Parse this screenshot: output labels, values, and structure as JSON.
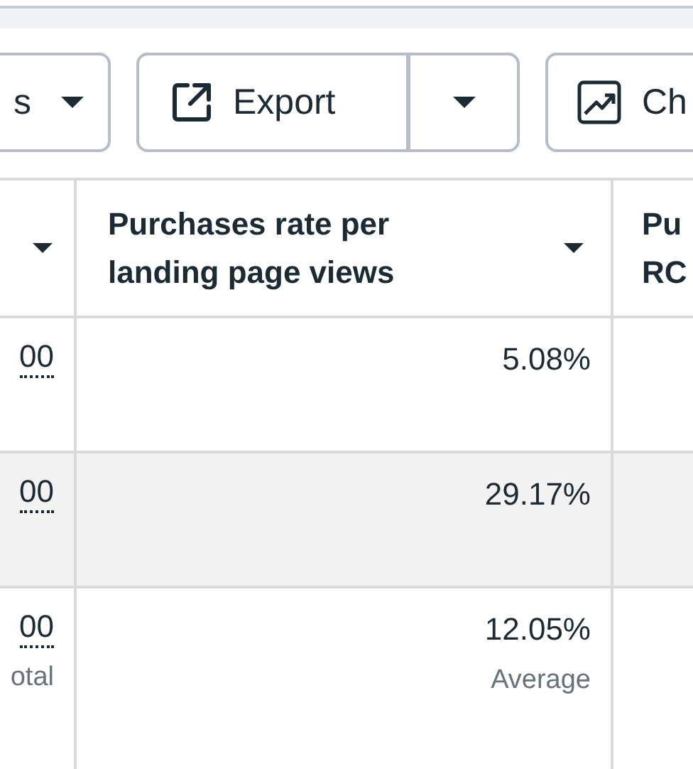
{
  "toolbar": [
    {
      "kind": "dropdown",
      "label": "s"
    },
    {
      "kind": "split",
      "label": "Export"
    },
    {
      "kind": "button",
      "label": "Ch"
    }
  ],
  "table": {
    "columns": [
      {
        "sort_menu": true
      },
      {
        "label": "Purchases rate per landing page views",
        "sort_menu": true
      },
      {
        "label": "Pu\nRC",
        "sort_menu": false
      }
    ],
    "rows": [
      {
        "highlighted": false,
        "cells": [
          {
            "value": "00",
            "kind": "link"
          },
          {
            "value": "5.08%"
          }
        ]
      },
      {
        "highlighted": true,
        "cells": [
          {
            "value": "00",
            "kind": "link"
          },
          {
            "value": "29.17%"
          }
        ]
      },
      {
        "highlighted": false,
        "cells": [
          {
            "value": "00",
            "kind": "link",
            "note": "otal"
          },
          {
            "value": "12.05%",
            "note": "Average"
          }
        ]
      }
    ]
  }
}
